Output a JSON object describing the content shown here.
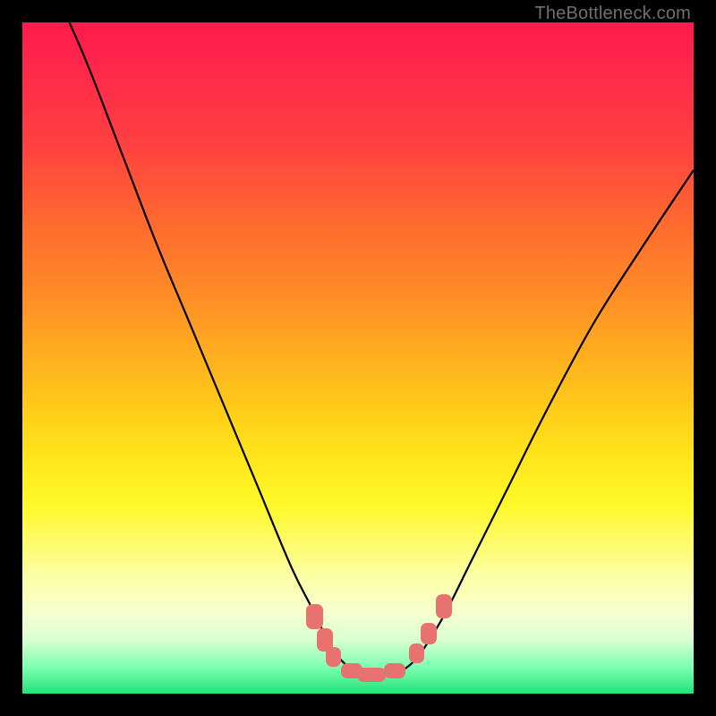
{
  "watermark": "TheBottleneck.com",
  "colors": {
    "curve_stroke": "#000000",
    "marker_fill": "#e77270",
    "frame_bg": "#000000"
  },
  "chart_data": {
    "type": "line",
    "title": "",
    "xlabel": "",
    "ylabel": "",
    "xlim": [
      0,
      100
    ],
    "ylim": [
      0,
      100
    ],
    "grid": false,
    "legend": false,
    "description": "Bottleneck-style V-curve over rainbow gradient background. Y is visual height from bottom (0=bottom, 100=top). The curve descends steeply from upper-left, flattens to a plateau near x≈47–57 at y≈3, then rises toward the right.",
    "series": [
      {
        "name": "curve",
        "x": [
          7,
          10,
          15,
          20,
          25,
          30,
          35,
          40,
          43,
          46,
          48,
          50,
          52,
          54,
          56,
          58,
          60,
          63,
          67,
          72,
          78,
          85,
          92,
          100
        ],
        "y": [
          100,
          93,
          80,
          67,
          55,
          43,
          31,
          19,
          13,
          7,
          4.5,
          3.2,
          2.8,
          2.8,
          3.2,
          4.5,
          7,
          12,
          20,
          30,
          42,
          55,
          66,
          78
        ]
      }
    ],
    "markers": {
      "description": "Rounded salmon lozenges clustered near the curve minimum. Each entry: center x,y in chart coords; w,h in percent of plot.",
      "items": [
        {
          "x": 43.5,
          "y": 11.5,
          "w": 2.5,
          "h": 3.8
        },
        {
          "x": 45.0,
          "y": 8.0,
          "w": 2.4,
          "h": 3.4
        },
        {
          "x": 46.3,
          "y": 5.5,
          "w": 2.3,
          "h": 3.0
        },
        {
          "x": 49.0,
          "y": 3.4,
          "w": 3.2,
          "h": 2.2
        },
        {
          "x": 52.0,
          "y": 2.8,
          "w": 4.3,
          "h": 2.2
        },
        {
          "x": 55.5,
          "y": 3.4,
          "w": 3.2,
          "h": 2.2
        },
        {
          "x": 58.7,
          "y": 6.0,
          "w": 2.3,
          "h": 3.0
        },
        {
          "x": 60.5,
          "y": 9.0,
          "w": 2.4,
          "h": 3.2
        },
        {
          "x": 62.8,
          "y": 13.0,
          "w": 2.5,
          "h": 3.6
        }
      ]
    }
  }
}
